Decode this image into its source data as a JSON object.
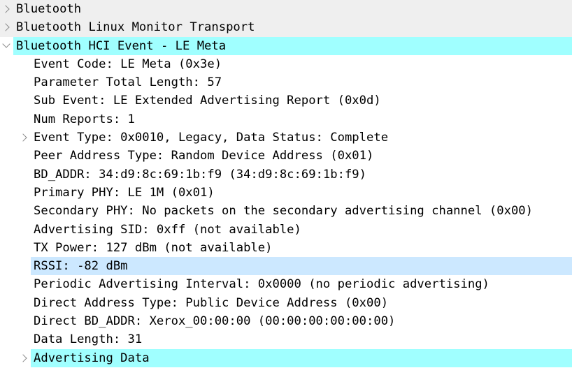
{
  "tree": [
    {
      "label": "Bluetooth",
      "level": 0,
      "expander": "collapsed",
      "highlight": "none",
      "top": true
    },
    {
      "label": "Bluetooth Linux Monitor Transport",
      "level": 0,
      "expander": "collapsed",
      "highlight": "none",
      "top": true
    },
    {
      "label": "Bluetooth HCI Event - LE Meta",
      "level": 0,
      "expander": "expanded",
      "highlight": "cyan"
    },
    {
      "label": "Event Code: LE Meta (0x3e)",
      "level": 1,
      "expander": "none",
      "highlight": "none"
    },
    {
      "label": "Parameter Total Length: 57",
      "level": 1,
      "expander": "none",
      "highlight": "none"
    },
    {
      "label": "Sub Event: LE Extended Advertising Report (0x0d)",
      "level": 1,
      "expander": "none",
      "highlight": "none"
    },
    {
      "label": "Num Reports: 1",
      "level": 1,
      "expander": "none",
      "highlight": "none"
    },
    {
      "label": "Event Type: 0x0010, Legacy, Data Status: Complete",
      "level": 1,
      "expander": "collapsed",
      "highlight": "none"
    },
    {
      "label": "Peer Address Type: Random Device Address (0x01)",
      "level": 1,
      "expander": "none",
      "highlight": "none"
    },
    {
      "label": "BD_ADDR: 34:d9:8c:69:1b:f9 (34:d9:8c:69:1b:f9)",
      "level": 1,
      "expander": "none",
      "highlight": "none"
    },
    {
      "label": "Primary PHY: LE 1M (0x01)",
      "level": 1,
      "expander": "none",
      "highlight": "none"
    },
    {
      "label": "Secondary PHY: No packets on the secondary advertising channel (0x00)",
      "level": 1,
      "expander": "none",
      "highlight": "none"
    },
    {
      "label": "Advertising SID: 0xff (not available)",
      "level": 1,
      "expander": "none",
      "highlight": "none"
    },
    {
      "label": "TX Power: 127 dBm (not available)",
      "level": 1,
      "expander": "none",
      "highlight": "none"
    },
    {
      "label": "RSSI: -82 dBm",
      "level": 1,
      "expander": "none",
      "highlight": "blue"
    },
    {
      "label": "Periodic Advertising Interval: 0x0000 (no periodic advertising)",
      "level": 1,
      "expander": "none",
      "highlight": "none"
    },
    {
      "label": "Direct Address Type: Public Device Address (0x00)",
      "level": 1,
      "expander": "none",
      "highlight": "none"
    },
    {
      "label": "Direct BD_ADDR: Xerox_00:00:00 (00:00:00:00:00:00)",
      "level": 1,
      "expander": "none",
      "highlight": "none"
    },
    {
      "label": "Data Length: 31",
      "level": 1,
      "expander": "none",
      "highlight": "none"
    },
    {
      "label": "Advertising Data",
      "level": 1,
      "expander": "collapsed",
      "highlight": "cyan"
    }
  ],
  "colors": {
    "top_row_bg": "#efefef",
    "highlight_cyan": "#a0ffff",
    "highlight_blue": "#cce8ff",
    "expander_arrow": "#8a8a8a"
  }
}
